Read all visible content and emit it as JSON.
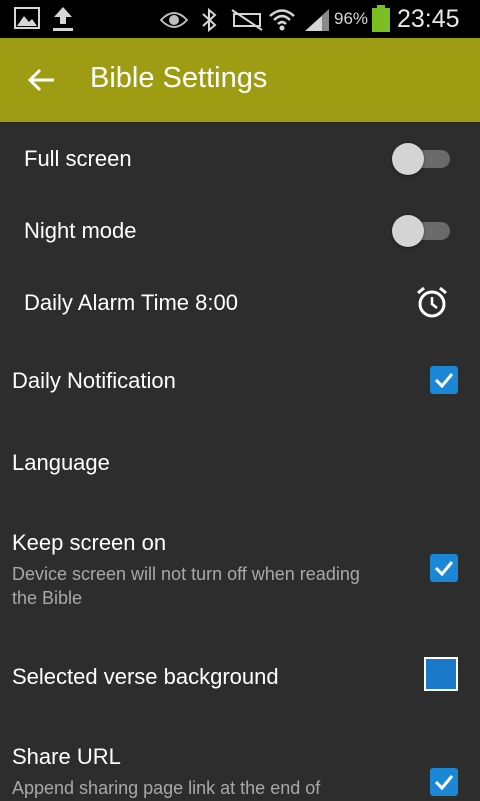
{
  "status_bar": {
    "battery_percent": "96%",
    "time": "23:45",
    "icons": [
      "gallery-icon",
      "upload-icon",
      "eye-icon",
      "bluetooth-icon",
      "mute-icon",
      "wifi-icon",
      "signal-icon",
      "battery-icon"
    ],
    "battery_color": "#7bbf22"
  },
  "app_bar": {
    "title": "Bible Settings",
    "background": "#9d9c12"
  },
  "settings": {
    "full_screen": {
      "label": "Full screen",
      "enabled": false
    },
    "night_mode": {
      "label": "Night mode",
      "enabled": false
    },
    "daily_alarm": {
      "label": "Daily Alarm Time 8:00",
      "icon": "alarm-clock-icon"
    },
    "daily_notification": {
      "label": "Daily Notification",
      "checked": true
    },
    "language": {
      "label": "Language"
    },
    "keep_screen_on": {
      "label": "Keep screen on",
      "summary": "Device screen will not turn off when reading the Bible",
      "checked": true
    },
    "selected_verse_background": {
      "label": "Selected verse background",
      "swatch_color": "#1a78c8"
    },
    "share_url": {
      "label": "Share URL",
      "summary": "Append sharing page link at the end of",
      "checked": true
    }
  },
  "colors": {
    "background": "#2d2d2d",
    "accent": "#1a88d6"
  }
}
